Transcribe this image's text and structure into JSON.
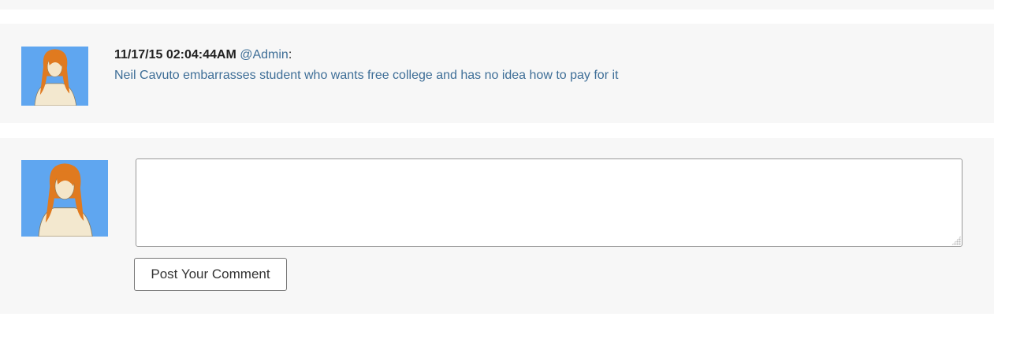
{
  "comment": {
    "timestamp": "11/17/15 02:04:44AM",
    "author": "@Admin",
    "separator": ":",
    "text": "Neil Cavuto embarrasses student who wants free college and has no idea how to pay for it",
    "avatar_icon": "user-avatar-icon"
  },
  "composer": {
    "avatar_icon": "user-avatar-icon",
    "input_value": "",
    "submit_label": "Post Your Comment"
  },
  "colors": {
    "panel_background": "#f7f7f7",
    "link": "#3e6e97",
    "avatar_background": "#5fa6f0"
  }
}
